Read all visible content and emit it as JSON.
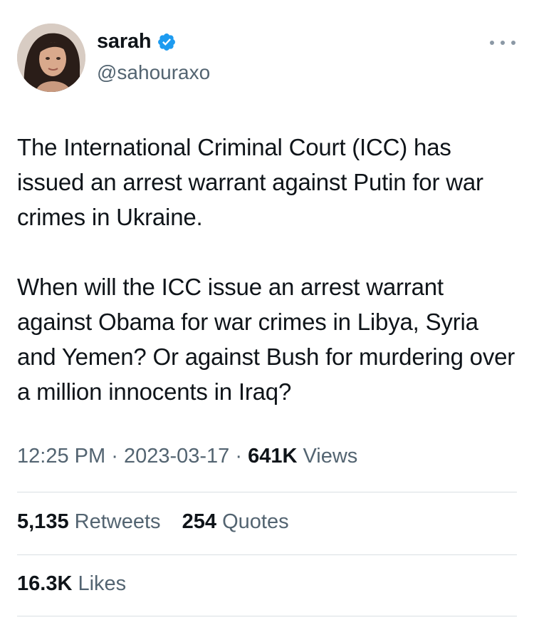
{
  "author": {
    "name": "sarah",
    "handle": "@sahouraxo",
    "verified": true
  },
  "tweet": {
    "paragraph_1": "The International Criminal Court (ICC) has issued an arrest warrant against Putin for war crimes in Ukraine.",
    "paragraph_2": "When will the ICC issue an arrest warrant against Obama for war crimes in Libya, Syria and Yemen? Or against Bush for murdering over a million innocents in Iraq?"
  },
  "meta": {
    "time": "12:25 PM",
    "separator": "·",
    "date": "2023-03-17",
    "views_count": "641K",
    "views_label": "Views"
  },
  "stats": {
    "retweets_count": "5,135",
    "retweets_label": "Retweets",
    "quotes_count": "254",
    "quotes_label": "Quotes",
    "likes_count": "16.3K",
    "likes_label": "Likes"
  },
  "colors": {
    "text": "#0f1419",
    "secondary": "#536471",
    "verified_badge": "#1d9bf0",
    "divider": "#d9dfe3"
  },
  "icons": {
    "verified": "verified-badge-icon",
    "more": "more-options-icon"
  }
}
